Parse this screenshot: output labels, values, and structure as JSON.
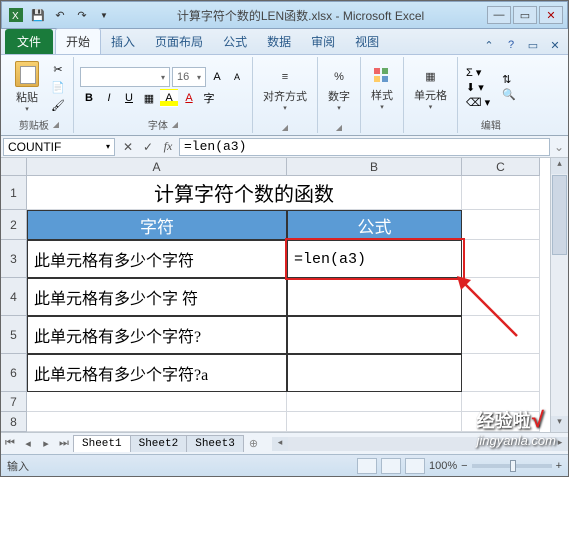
{
  "title": "计算字符个数的LEN函数.xlsx - Microsoft Excel",
  "ribbon": {
    "file": "文件",
    "tabs": [
      "开始",
      "插入",
      "页面布局",
      "公式",
      "数据",
      "审阅",
      "视图"
    ],
    "active_tab": "开始",
    "clipboard": {
      "paste": "粘贴",
      "label": "剪贴板"
    },
    "font": {
      "name": "",
      "size": "16",
      "label": "字体"
    },
    "align": {
      "label": "对齐方式"
    },
    "number": {
      "label": "数字"
    },
    "styles": {
      "label": "样式"
    },
    "cells": {
      "label": "单元格"
    },
    "editing": {
      "label": "编辑"
    }
  },
  "namebox": "COUNTIF",
  "formula_bar": "=len(a3)",
  "columns": [
    "A",
    "B",
    "C"
  ],
  "rows": [
    "1",
    "2",
    "3",
    "4",
    "5",
    "6",
    "7",
    "8"
  ],
  "sheet": {
    "title_merged": "计算字符个数的函数",
    "headers": [
      "字符",
      "公式"
    ],
    "data": [
      {
        "a": "此单元格有多少个字符",
        "b": "=len(a3)"
      },
      {
        "a": "此单元格有多少个字 符",
        "b": ""
      },
      {
        "a": "此单元格有多少个字符?",
        "b": ""
      },
      {
        "a": "此单元格有多少个字符?a",
        "b": ""
      }
    ]
  },
  "sheet_tabs": [
    "Sheet1",
    "Sheet2",
    "Sheet3"
  ],
  "active_sheet": "Sheet1",
  "status": {
    "mode": "输入",
    "zoom": "100%"
  },
  "watermark": {
    "main": "经验啦",
    "sub": "jingyanla.com"
  }
}
